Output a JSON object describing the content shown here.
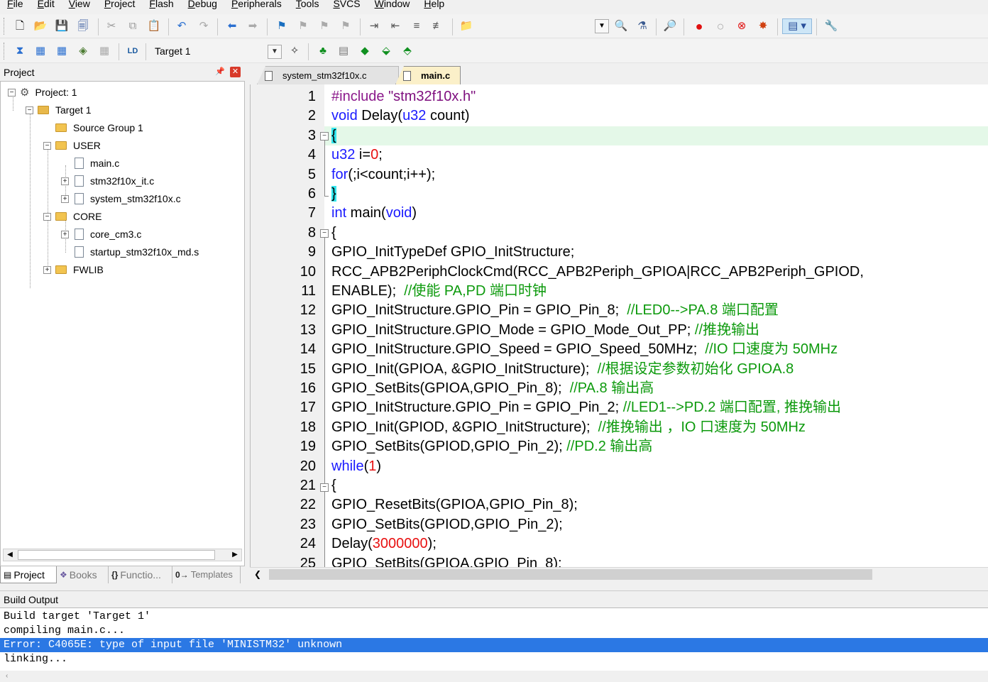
{
  "menu": [
    "File",
    "Edit",
    "View",
    "Project",
    "Flash",
    "Debug",
    "Peripherals",
    "Tools",
    "SVCS",
    "Window",
    "Help"
  ],
  "toolbar2": {
    "target": "Target 1"
  },
  "project_pane": {
    "title": "Project",
    "tree": [
      {
        "label": "Project: 1"
      },
      {
        "label": "Target 1"
      },
      {
        "label": "Source Group 1"
      },
      {
        "label": "USER"
      },
      {
        "label": "main.c"
      },
      {
        "label": "stm32f10x_it.c"
      },
      {
        "label": "system_stm32f10x.c"
      },
      {
        "label": "CORE"
      },
      {
        "label": "core_cm3.c"
      },
      {
        "label": "startup_stm32f10x_md.s"
      },
      {
        "label": "FWLIB"
      }
    ],
    "tabs": [
      "Project",
      "Books",
      "Functio...",
      "Templates"
    ]
  },
  "editor": {
    "tabs": [
      "system_stm32f10x.c",
      "main.c"
    ],
    "active_tab": "main.c",
    "line_numbers": [
      "1",
      "2",
      "3",
      "4",
      "5",
      "6",
      "7",
      "8",
      "9",
      "10",
      "11",
      "12",
      "13",
      "14",
      "15",
      "16",
      "17",
      "18",
      "19",
      "20",
      "21",
      "22",
      "23",
      "24",
      "25"
    ],
    "lines": [
      [
        {
          "t": "#include ",
          "c": "pp"
        },
        {
          "t": "\"stm32f10x.h\"",
          "c": "str"
        }
      ],
      [
        {
          "t": "void",
          "c": "kw"
        },
        {
          "t": " Delay(",
          "c": ""
        },
        {
          "t": "u32",
          "c": "kw"
        },
        {
          "t": " count)",
          "c": ""
        }
      ],
      [
        {
          "t": "{",
          "c": "brace"
        }
      ],
      [
        {
          "t": "u32",
          "c": "kw"
        },
        {
          "t": " i=",
          "c": ""
        },
        {
          "t": "0",
          "c": "num"
        },
        {
          "t": ";",
          "c": ""
        }
      ],
      [
        {
          "t": "for",
          "c": "kw"
        },
        {
          "t": "(;i<count;i++);",
          "c": ""
        }
      ],
      [
        {
          "t": "}",
          "c": "brace"
        }
      ],
      [
        {
          "t": "int",
          "c": "kw"
        },
        {
          "t": " main(",
          "c": ""
        },
        {
          "t": "void",
          "c": "kw"
        },
        {
          "t": ")",
          "c": ""
        }
      ],
      [
        {
          "t": "{",
          "c": ""
        }
      ],
      [
        {
          "t": "GPIO_InitTypeDef GPIO_InitStructure;",
          "c": ""
        }
      ],
      [
        {
          "t": "RCC_APB2PeriphClockCmd(RCC_APB2Periph_GPIOA|RCC_APB2Periph_GPIOD,",
          "c": ""
        }
      ],
      [
        {
          "t": "ENABLE);  ",
          "c": ""
        },
        {
          "t": "//使能 PA,PD 端口时钟",
          "c": "cm"
        }
      ],
      [
        {
          "t": "GPIO_InitStructure.GPIO_Pin = GPIO_Pin_8;  ",
          "c": ""
        },
        {
          "t": "//LED0-->PA.8 端口配置",
          "c": "cm"
        }
      ],
      [
        {
          "t": "GPIO_InitStructure.GPIO_Mode = GPIO_Mode_Out_PP; ",
          "c": ""
        },
        {
          "t": "//推挽输出",
          "c": "cm"
        }
      ],
      [
        {
          "t": "GPIO_InitStructure.GPIO_Speed = GPIO_Speed_50MHz;  ",
          "c": ""
        },
        {
          "t": "//IO 口速度为 50MHz",
          "c": "cm"
        }
      ],
      [
        {
          "t": "GPIO_Init(GPIOA, &GPIO_InitStructure);  ",
          "c": ""
        },
        {
          "t": "//根据设定参数初始化 GPIOA.8",
          "c": "cm"
        }
      ],
      [
        {
          "t": "GPIO_SetBits(GPIOA,GPIO_Pin_8);  ",
          "c": ""
        },
        {
          "t": "//PA.8 输出高",
          "c": "cm"
        }
      ],
      [
        {
          "t": "GPIO_InitStructure.GPIO_Pin = GPIO_Pin_2; ",
          "c": ""
        },
        {
          "t": "//LED1-->PD.2 端口配置, 推挽输出",
          "c": "cm"
        }
      ],
      [
        {
          "t": "GPIO_Init(GPIOD, &GPIO_InitStructure);  ",
          "c": ""
        },
        {
          "t": "//推挽输出 ，IO 口速度为 50MHz",
          "c": "cm"
        }
      ],
      [
        {
          "t": "GPIO_SetBits(GPIOD,GPIO_Pin_2); ",
          "c": ""
        },
        {
          "t": "//PD.2 输出高",
          "c": "cm"
        }
      ],
      [
        {
          "t": "while",
          "c": "kw"
        },
        {
          "t": "(",
          "c": ""
        },
        {
          "t": "1",
          "c": "num"
        },
        {
          "t": ")",
          "c": ""
        }
      ],
      [
        {
          "t": "{",
          "c": ""
        }
      ],
      [
        {
          "t": "GPIO_ResetBits(GPIOA,GPIO_Pin_8);",
          "c": ""
        }
      ],
      [
        {
          "t": "GPIO_SetBits(GPIOD,GPIO_Pin_2);",
          "c": ""
        }
      ],
      [
        {
          "t": "Delay(",
          "c": ""
        },
        {
          "t": "3000000",
          "c": "num"
        },
        {
          "t": ");",
          "c": ""
        }
      ],
      [
        {
          "t": "GPIO_SetBits(GPIOA,GPIO_Pin_8);",
          "c": ""
        }
      ]
    ]
  },
  "build_output": {
    "title": "Build Output",
    "lines": [
      "Build target 'Target 1'",
      "compiling main.c...",
      "Error: C4065E: type of input file 'MINISTM32' unknown",
      "linking..."
    ]
  },
  "colors": {
    "selection": "#2b78e4",
    "current_line": "#e4f8e8",
    "keyword": "#1a1aff",
    "comment": "#0d9a0d",
    "number": "#e81010"
  },
  "icons": {
    "toolbar1": [
      "new-file-icon",
      "open-file-icon",
      "save-icon",
      "save-all-icon",
      "cut-icon",
      "copy-icon",
      "paste-icon",
      "undo-icon",
      "redo-icon",
      "nav-back-icon",
      "nav-forward-icon",
      "bookmark-icon",
      "bookmark-prev-icon",
      "bookmark-next-icon",
      "bookmark-clear-icon",
      "indent-icon",
      "unindent-icon",
      "comment-icon",
      "uncomment-icon",
      "find-in-files-icon",
      "find-icon",
      "incremental-find-icon",
      "debug-session-icon",
      "breakpoint-icon",
      "breakpoint-disable-icon",
      "breakpoint-disable-all-icon",
      "breakpoint-kill-all-icon",
      "window-layout-icon",
      "configure-icon"
    ],
    "toolbar2": [
      "translate-icon",
      "build-icon",
      "rebuild-icon",
      "batch-build-icon",
      "stop-build-icon",
      "download-icon",
      "target-options-icon",
      "manage-components-icon",
      "file-extensions-icon",
      "select-packs-icon",
      "pack-installer-icon",
      "rte-icon"
    ]
  }
}
